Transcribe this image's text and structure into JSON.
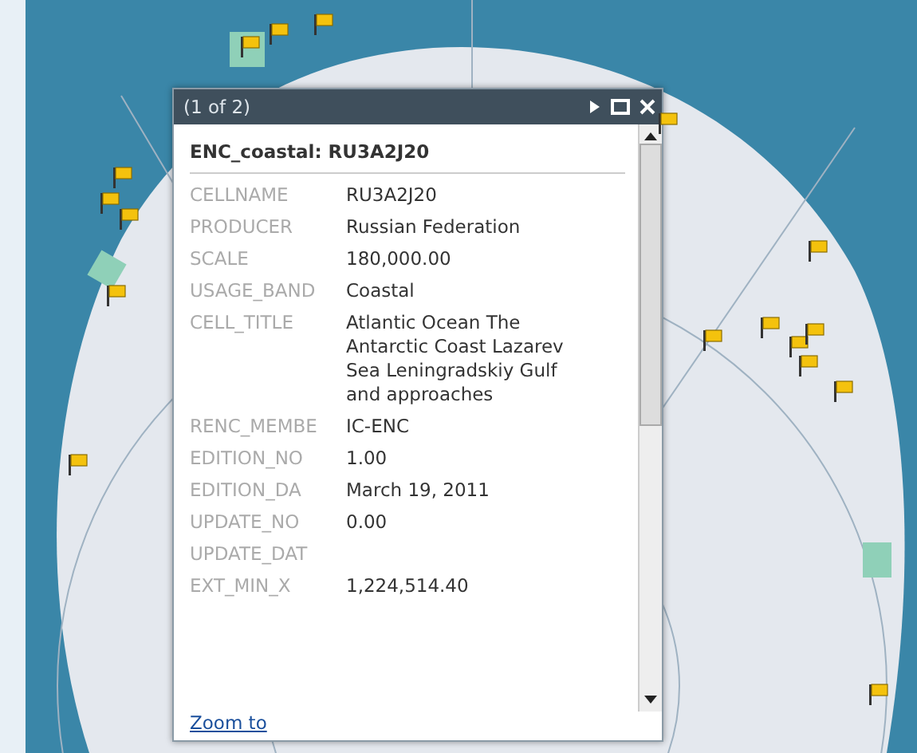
{
  "popup": {
    "counter": "(1 of 2)",
    "title": "ENC_coastal: RU3A2J20",
    "fields": [
      {
        "label": "CELLNAME",
        "value": "RU3A2J20"
      },
      {
        "label": "PRODUCER",
        "value": "Russian Federation"
      },
      {
        "label": "SCALE",
        "value": "180,000.00"
      },
      {
        "label": "USAGE_BAND",
        "value": "Coastal"
      },
      {
        "label": "CELL_TITLE",
        "value": "Atlantic Ocean The Antarctic Coast Lazarev Sea Leningradskiy Gulf and approaches"
      },
      {
        "label": "RENC_MEMBE",
        "value": "IC-ENC"
      },
      {
        "label": "EDITION_NO",
        "value": "1.00"
      },
      {
        "label": "EDITION_DA",
        "value": "March 19, 2011"
      },
      {
        "label": "UPDATE_NO",
        "value": "0.00"
      },
      {
        "label": "UPDATE_DAT"
      },
      {
        "label": "EXT_MIN_X",
        "value": "1,224,514.40"
      }
    ],
    "link": "Zoom to"
  }
}
